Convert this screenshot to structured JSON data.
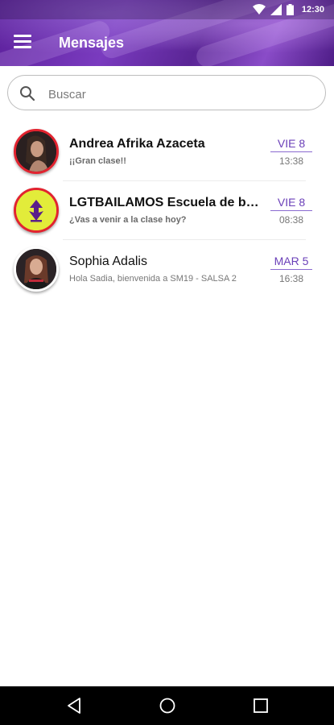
{
  "status_bar": {
    "time": "12:30"
  },
  "header": {
    "title": "Mensajes",
    "menu_icon": "hamburger-menu-icon"
  },
  "search": {
    "placeholder": "Buscar",
    "value": ""
  },
  "conversations": [
    {
      "name": "Andrea Afrika Azaceta",
      "preview": "¡¡Gran clase!!",
      "date": "VIE 8",
      "time": "13:38",
      "unread": true
    },
    {
      "name": "LGTBAILAMOS Escuela de baile",
      "preview": "¿Vas a venir a la clase hoy?",
      "date": "VIE 8",
      "time": "08:38",
      "unread": true
    },
    {
      "name": "Sophia Adalis",
      "preview": "Hola Sadia, bienvenida a SM19 - SALSA 2",
      "date": "MAR 5",
      "time": "16:38",
      "unread": false
    }
  ],
  "colors": {
    "accent": "#6a3fb8",
    "header": "#6b2fb0",
    "unread_ring": "#e2232f",
    "brand_yellow": "#e2ec3a"
  }
}
